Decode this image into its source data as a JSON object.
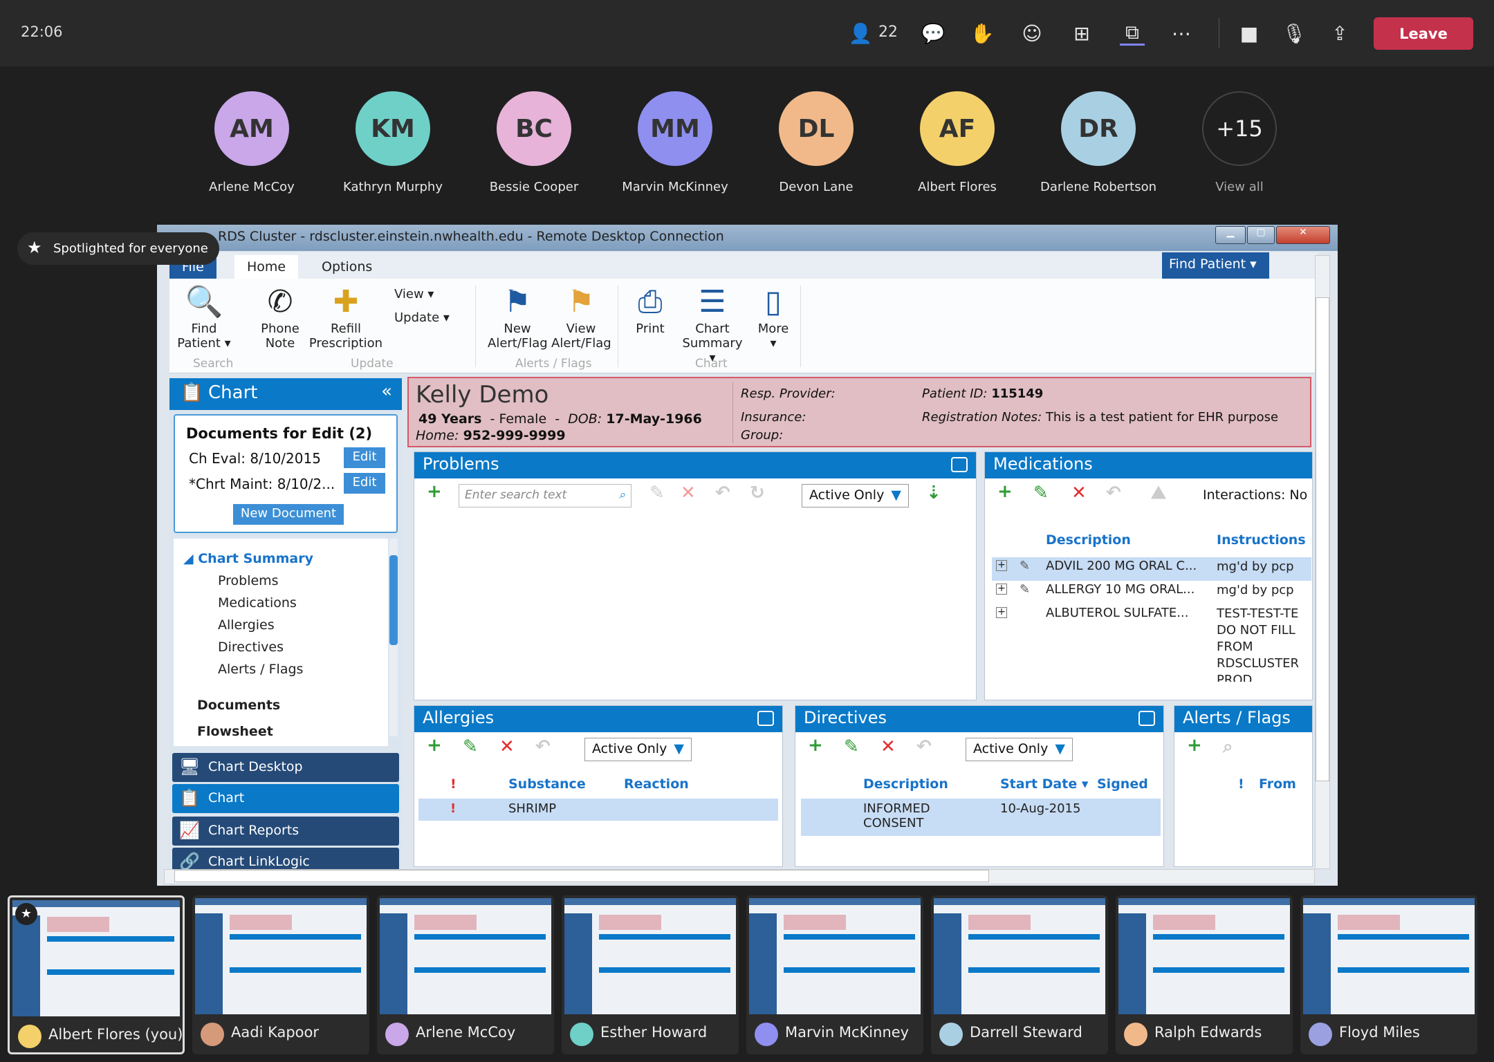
{
  "topbar": {
    "time": "22:06",
    "participant_count": "22",
    "leave_label": "Leave",
    "icons": [
      "people-icon",
      "chat-icon",
      "raise-hand-icon",
      "reactions-icon",
      "apps-icon",
      "share-screen-icon",
      "more-icon",
      "camera-icon",
      "mic-icon",
      "share-tray-icon"
    ]
  },
  "participants": [
    {
      "name": "Arlene McCoy",
      "color": "#c9a7e8"
    },
    {
      "name": "Kathryn Murphy",
      "color": "#6fd0c8"
    },
    {
      "name": "Bessie Cooper",
      "color": "#e7b3d9"
    },
    {
      "name": "Marvin McKinney",
      "color": "#8f8ff0"
    },
    {
      "name": "Devon Lane",
      "color": "#f1b98a"
    },
    {
      "name": "Albert Flores",
      "color": "#f3d06a"
    },
    {
      "name": "Darlene Robertson",
      "color": "#a9cfe3"
    }
  ],
  "overflow": {
    "count": "+15",
    "label": "View all"
  },
  "spotlight": {
    "label": "Spotlighted for everyone"
  },
  "remote": {
    "window_title": "RDS Cluster - rdscluster.einstein.nwhealth.edu - Remote Desktop Connection",
    "tabs": [
      "File",
      "Home",
      "Options"
    ],
    "find_patient": "Find Patient",
    "ribbon": {
      "find_patient": "Find Patient ▾",
      "phone_note": "Phone Note",
      "refill": "Refill Prescription",
      "view": "View ▾",
      "update": "Update ▾",
      "new_alert": "New Alert/Flag",
      "view_alert": "View Alert/Flag",
      "print": "Print",
      "chart_summary": "Chart Summary ▾",
      "more": "More ▾",
      "groups": [
        "Search",
        "Update",
        "Alerts / Flags",
        "Chart"
      ]
    },
    "sidebar": {
      "title": "Chart",
      "docs_title": "Documents for Edit (2)",
      "docs": [
        {
          "name": "Ch Eval: 8/10/2015",
          "action": "Edit"
        },
        {
          "name": "*Chrt Maint: 8/10/2...",
          "action": "Edit"
        }
      ],
      "new_document": "New Document",
      "tree_root": "Chart Summary",
      "tree_items": [
        "Problems",
        "Medications",
        "Allergies",
        "Directives",
        "Alerts / Flags"
      ],
      "sections": [
        "Documents",
        "Flowsheet"
      ],
      "nav": [
        "Chart Desktop",
        "Chart",
        "Chart Reports",
        "Chart LinkLogic"
      ]
    },
    "patient": {
      "name": "Kelly Demo",
      "age": "49 Years",
      "sex": "Female",
      "dob_label": "DOB:",
      "dob": "17-May-1966",
      "home_label": "Home:",
      "home": "952-999-9999",
      "resp_provider": "Resp. Provider:",
      "insurance": "Insurance:",
      "group": "Group:",
      "patient_id_label": "Patient ID:",
      "patient_id": "115149",
      "reg_notes_label": "Registration Notes:",
      "reg_notes": "This is a test patient for EHR purpose"
    },
    "problems": {
      "title": "Problems",
      "search_placeholder": "Enter search text",
      "filter": "Active Only"
    },
    "medications": {
      "title": "Medications",
      "interactions": "Interactions: No",
      "columns": [
        "Description",
        "Instructions"
      ],
      "rows": [
        {
          "description": "ADVIL 200 MG ORAL C...",
          "instructions": "mg'd by pcp"
        },
        {
          "description": "ALLERGY 10 MG ORAL...",
          "instructions": "mg'd by pcp"
        },
        {
          "description": "ALBUTEROL SULFATE...",
          "instructions": "TEST-TEST-TE DO NOT FILL FROM RDSCLUSTER PROD"
        }
      ]
    },
    "allergies": {
      "title": "Allergies",
      "filter": "Active Only",
      "columns": [
        "!",
        "Substance",
        "Reaction"
      ],
      "rows": [
        {
          "flag": "!",
          "substance": "SHRIMP",
          "reaction": ""
        }
      ]
    },
    "directives": {
      "title": "Directives",
      "filter": "Active Only",
      "columns": [
        "Description",
        "Start Date ▾",
        "Signed"
      ],
      "rows": [
        {
          "description": "INFORMED CONSENT",
          "start_date": "10-Aug-2015",
          "signed": ""
        }
      ]
    },
    "alerts": {
      "title": "Alerts / Flags",
      "columns": [
        "!",
        "From"
      ]
    }
  },
  "gallery": [
    {
      "name": "Albert Flores (you)",
      "color": "#f3d06a",
      "active": true
    },
    {
      "name": "Aadi Kapoor",
      "color": "#d59a7a"
    },
    {
      "name": "Arlene McCoy",
      "color": "#c9a7e8"
    },
    {
      "name": "Esther Howard",
      "color": "#6fd0c8"
    },
    {
      "name": "Marvin McKinney",
      "color": "#8f8ff0"
    },
    {
      "name": "Darrell Steward",
      "color": "#a9cfe3"
    },
    {
      "name": "Ralph Edwards",
      "color": "#f1b98a"
    },
    {
      "name": "Floyd Miles",
      "color": "#9aa0e0"
    }
  ]
}
